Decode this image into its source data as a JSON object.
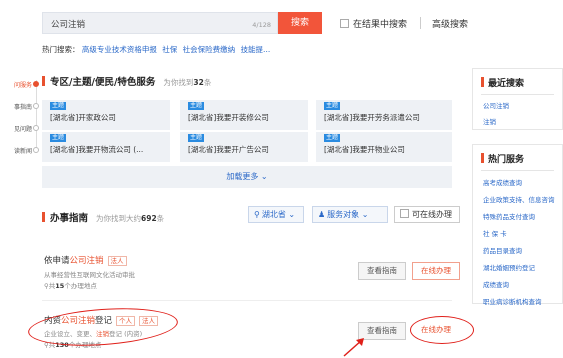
{
  "search": {
    "value": "公司注销",
    "count": "4/128",
    "button": "搜索",
    "in_result": "在结果中搜索",
    "advanced": "高级搜索"
  },
  "hot": {
    "label": "热门搜索：",
    "links": [
      "高级专业技术资格申报",
      "社保",
      "社会保险费缴纳",
      "技能提..."
    ]
  },
  "rail": [
    "问服务",
    "事指南",
    "见问题",
    "读新闻"
  ],
  "topics": {
    "title": "专区/主题/便民/特色服务",
    "found_prefix": "为你找到",
    "found_count": "32",
    "found_suffix": "条",
    "cards": [
      {
        "tag": "主题",
        "text": "[湖北省]开家政公司"
      },
      {
        "tag": "主题",
        "text": "[湖北省]我要开装修公司"
      },
      {
        "tag": "主题",
        "text": "[湖北省]我要开劳务派遣公司"
      },
      {
        "tag": "主题",
        "text": "[湖北省]我要开物流公司 (..."
      },
      {
        "tag": "主题",
        "text": "[湖北省]我要开广告公司"
      },
      {
        "tag": "主题",
        "text": "[湖北省]我要开物业公司"
      }
    ],
    "more": "加载更多 ⌄"
  },
  "guide": {
    "title": "办事指南",
    "found_prefix": "为你找到大约",
    "found_count": "692",
    "found_suffix": "条",
    "filter_region": "湖北省",
    "filter_target": "服务对象",
    "filter_online": "可在线办理",
    "items": [
      {
        "t_pre": "依申请",
        "t_hl": "公司注销",
        "t_post": "",
        "badges": [
          "法人"
        ],
        "sub_pre": "从事经营性互联网文化活动审批",
        "sub_hl": "",
        "sub_post": "",
        "cnt_pre": "共",
        "cnt": "15",
        "cnt_post": "个办理地点",
        "view": "查看指南",
        "online": "在线办理"
      },
      {
        "t_pre": "内资",
        "t_hl": "公司注销",
        "t_post": "登记",
        "badges": [
          "个人",
          "法人"
        ],
        "sub_pre": "企业设立、变更、",
        "sub_hl": "注销",
        "sub_post": "登记 (内资)",
        "cnt_pre": "共",
        "cnt": "130",
        "cnt_post": "个办理地点",
        "view": "查看指南",
        "online": "在线办理"
      }
    ]
  },
  "recent": {
    "title": "最近搜索",
    "items": [
      "公司注销",
      "注销"
    ]
  },
  "services": {
    "title": "热门服务",
    "items": [
      "高考成绩查询",
      "企业政策支持、信息咨询",
      "特殊药品支付查询",
      "社 保 卡",
      "药品目录查询",
      "湖北婚姻预约登记",
      "成绩查询",
      "职业病诊断机构查询"
    ]
  }
}
